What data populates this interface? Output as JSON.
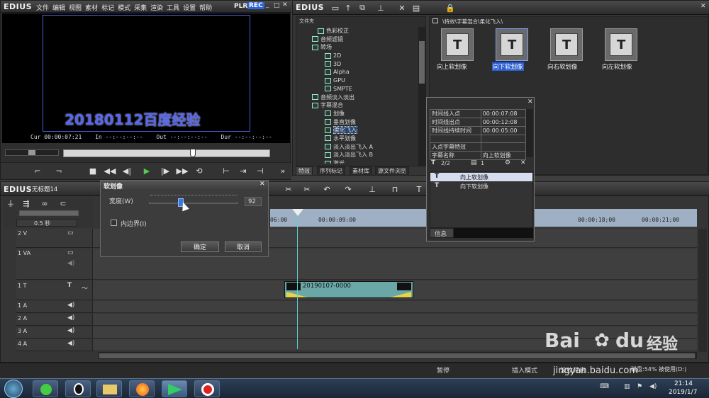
{
  "player": {
    "logo": "EDIUS",
    "menu": [
      "文件",
      "编辑",
      "视图",
      "素材",
      "标记",
      "模式",
      "采集",
      "渲染",
      "工具",
      "设置",
      "帮助"
    ],
    "plr": "PLR",
    "rec": "REC",
    "preview_text": "20180112百度经验",
    "cur_label": "Cur",
    "cur_value": "00:00:07:21",
    "in_label": "In",
    "in_value": "--:--:--:--",
    "out_label": "Out",
    "out_value": "--:--:--:--",
    "dur_label": "Dur",
    "dur_value": "--:--:--:--"
  },
  "effects": {
    "logo": "EDIUS",
    "folder_header": "文件夹",
    "path": "\\特效\\字幕混合\\柔化飞入\\",
    "tree": [
      "色彩校正",
      "音频滤镜",
      "转场",
      "2D",
      "3D",
      "Alpha",
      "GPU",
      "SMPTE",
      "音频淡入淡出",
      "字幕混合",
      "划像",
      "垂直划像",
      "柔化飞入",
      "水平划像",
      "淡入淡出飞入 A",
      "淡入淡出飞入 B",
      "激光"
    ],
    "thumbs": [
      {
        "label": "向上软划像"
      },
      {
        "label": "向下软划像"
      },
      {
        "label": "向右软划像"
      },
      {
        "label": "向左软划像"
      }
    ],
    "tabs": [
      "特效",
      "序列标记",
      "素材库",
      "源文件浏览"
    ]
  },
  "info_panel": {
    "props": [
      [
        "时间线入点",
        "00:00:07:08"
      ],
      [
        "时间线出点",
        "00:00:12:08"
      ],
      [
        "时间线持续时间",
        "00:00:05:00"
      ],
      [
        "",
        ""
      ],
      [
        "入点字幕特效",
        ""
      ],
      [
        "字幕名称",
        "向上软划像"
      ]
    ],
    "counter1": "2/2",
    "counter2": "1",
    "items": [
      "向上软划像",
      "向下软划像"
    ],
    "tab": "信息"
  },
  "timeline": {
    "logo": "EDIUS",
    "project_name": "无标题14",
    "zoom": "0.5 秒",
    "ruler": [
      "06:00",
      "00:00:09:00",
      "00:00:18;00",
      "00:00:21;00"
    ],
    "tracks": [
      "2 V",
      "1 VA",
      "1 T",
      "1 A",
      "2 A",
      "3 A",
      "4 A"
    ],
    "clip_name": "20190107-0000"
  },
  "dialog": {
    "title": "软划像",
    "width_label": "宽度(W)",
    "width_value": "92",
    "checkbox_label": "内边界(I)",
    "ok": "确定",
    "cancel": "取消"
  },
  "status": {
    "pause": "暂停",
    "insert_mode": "插入模式",
    "ripple": "波纹开启",
    "disk": "磁盘:54% 被使用(D:)"
  },
  "taskbar": {
    "time": "21:14",
    "date": "2019/1/7",
    "watermark": "jingyan.baidu.com",
    "watermark_logo": "Bai",
    "watermark_logo2": "du",
    "watermark_logo3": "经验"
  },
  "colors": {
    "accent": "#3a5ec6",
    "clip": "#6aa8a8",
    "timeline_bar": "#a0b0c8"
  }
}
